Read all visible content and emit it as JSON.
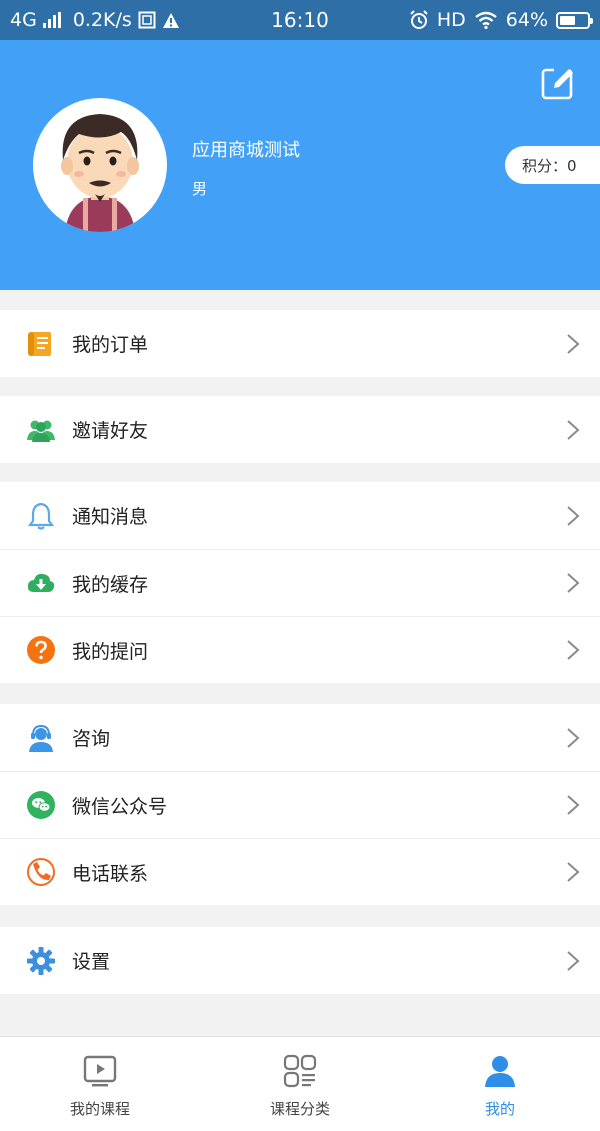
{
  "status_bar": {
    "network": "4G",
    "speed": "0.2K/s",
    "time": "16:10",
    "hd": "HD",
    "battery_text": "64%",
    "battery_level": 0.64
  },
  "profile": {
    "username": "应用商城测试",
    "gender": "男",
    "points_label": "积分：0"
  },
  "menu_groups": [
    [
      {
        "label": "我的订单",
        "icon": "order-scroll-icon"
      }
    ],
    [
      {
        "label": "邀请好友",
        "icon": "friends-icon"
      }
    ],
    [
      {
        "label": "通知消息",
        "icon": "bell-icon"
      },
      {
        "label": "我的缓存",
        "icon": "cloud-download-icon"
      },
      {
        "label": "我的提问",
        "icon": "question-icon"
      }
    ],
    [
      {
        "label": "咨询",
        "icon": "headset-user-icon"
      },
      {
        "label": "微信公众号",
        "icon": "wechat-icon"
      },
      {
        "label": "电话联系",
        "icon": "phone-icon"
      }
    ],
    [
      {
        "label": "设置",
        "icon": "gear-icon"
      }
    ]
  ],
  "tabs": [
    {
      "label": "我的课程",
      "icon": "play-screen-icon",
      "active": false
    },
    {
      "label": "课程分类",
      "icon": "category-grid-icon",
      "active": false
    },
    {
      "label": "我的",
      "icon": "user-icon",
      "active": true
    }
  ],
  "colors": {
    "header": "#42a1f6",
    "status_bar": "#2f6fa8",
    "active_tab": "#2f8ee8"
  }
}
